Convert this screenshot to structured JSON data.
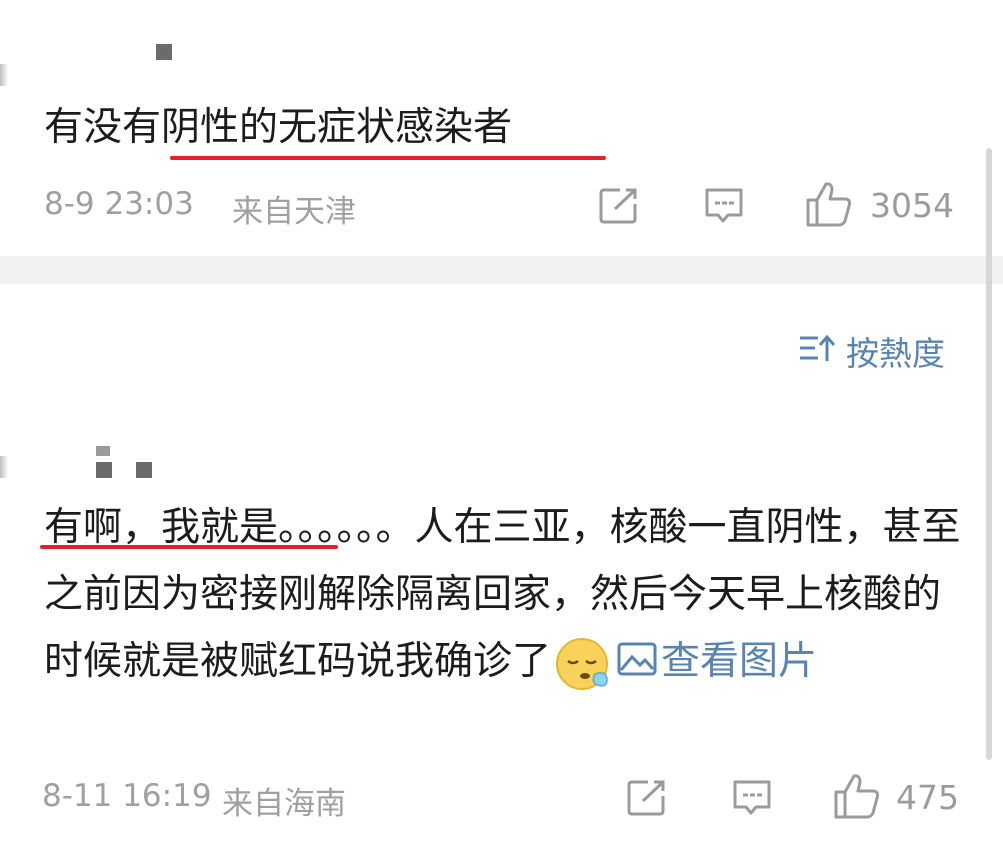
{
  "post": {
    "text": "有没有阴性的无症状感染者",
    "date": "8-9 23:03",
    "source": "来自天津",
    "likes": "3054"
  },
  "sort": {
    "label": "按熱度"
  },
  "comment": {
    "text_start": "有啊，我就是。。。。。。人在三亚，核酸一直阴性，甚至之前因为密接刚解除隔离回家，然后今天早上核酸的时候就是被赋红码说我确诊了",
    "view_image": "查看图片",
    "date": "8-11 16:19",
    "source": "来自海南",
    "likes": "475"
  },
  "colors": {
    "accent": "#5a84b0",
    "underline": "#e0232b",
    "meta": "#a0a0a0"
  },
  "icons": [
    "share-icon",
    "comment-icon",
    "thumbs-up-icon",
    "sort-icon",
    "image-icon",
    "sleepy-emoji"
  ]
}
